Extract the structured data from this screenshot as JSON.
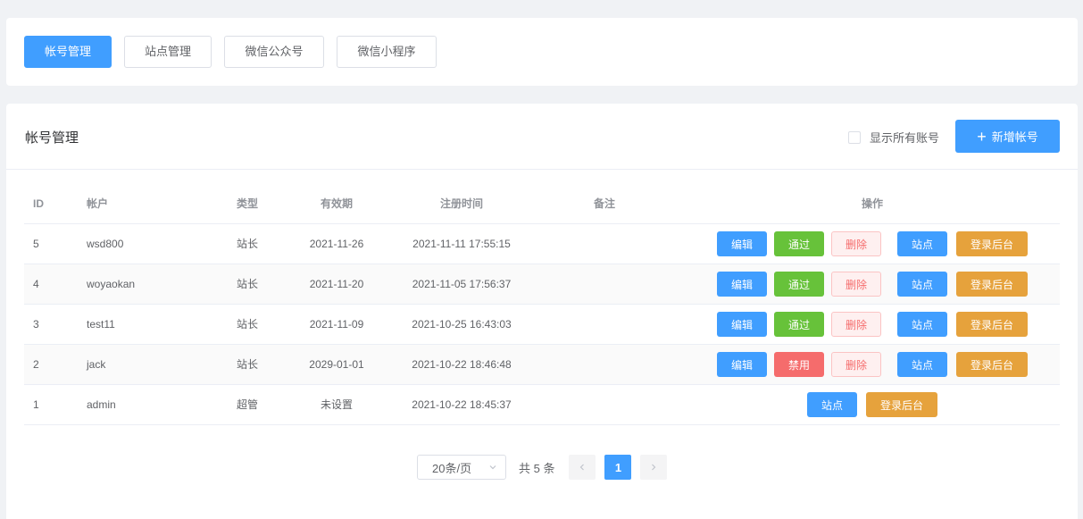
{
  "nav": {
    "tabs": [
      {
        "label": "帐号管理",
        "active": true
      },
      {
        "label": "站点管理",
        "active": false
      },
      {
        "label": "微信公众号",
        "active": false
      },
      {
        "label": "微信小程序",
        "active": false
      }
    ]
  },
  "main": {
    "title": "帐号管理",
    "show_all_label": "显示所有账号",
    "show_all_checked": false,
    "add_button_label": "新增帐号",
    "add_icon": "plus-icon"
  },
  "table": {
    "columns": [
      "ID",
      "帐户",
      "类型",
      "有效期",
      "注册时间",
      "备注",
      "操作"
    ],
    "rows": [
      {
        "id": "5",
        "user": "wsd800",
        "type": "站长",
        "expiry": "2021-11-26",
        "registered": "2021-11-11 17:55:15",
        "note": "",
        "status_action": "通过"
      },
      {
        "id": "4",
        "user": "woyaokan",
        "type": "站长",
        "expiry": "2021-11-20",
        "registered": "2021-11-05 17:56:37",
        "note": "",
        "status_action": "通过"
      },
      {
        "id": "3",
        "user": "test11",
        "type": "站长",
        "expiry": "2021-11-09",
        "registered": "2021-10-25 16:43:03",
        "note": "",
        "status_action": "通过"
      },
      {
        "id": "2",
        "user": "jack",
        "type": "站长",
        "expiry": "2029-01-01",
        "registered": "2021-10-22 18:46:48",
        "note": "",
        "status_action": "禁用"
      },
      {
        "id": "1",
        "user": "admin",
        "type": "超管",
        "expiry": "未设置",
        "registered": "2021-10-22 18:45:37",
        "note": ""
      }
    ],
    "actions": {
      "edit": "编辑",
      "delete": "删除",
      "site": "站点",
      "login": "登录后台"
    }
  },
  "pagination": {
    "page_size": "20条/页",
    "total": "共 5 条",
    "current_page": "1",
    "prev_icon": "chevron-left-icon",
    "next_icon": "chevron-right-icon"
  },
  "colors": {
    "primary": "#409eff",
    "success": "#67c23a",
    "danger": "#f56c6c",
    "warning": "#e6a23c"
  }
}
